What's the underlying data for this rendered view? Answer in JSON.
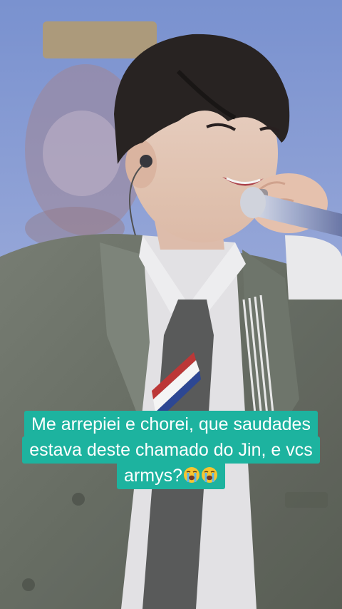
{
  "caption": {
    "line1": "Me arrepiei e chorei, que saudades",
    "line2": "estava deste chamado do Jin, e vcs",
    "line3": "armys?",
    "emoji": [
      "loudly-crying-face-emoji",
      "loudly-crying-face-emoji"
    ],
    "background_color": "#1db39f",
    "text_color": "#ffffff"
  }
}
